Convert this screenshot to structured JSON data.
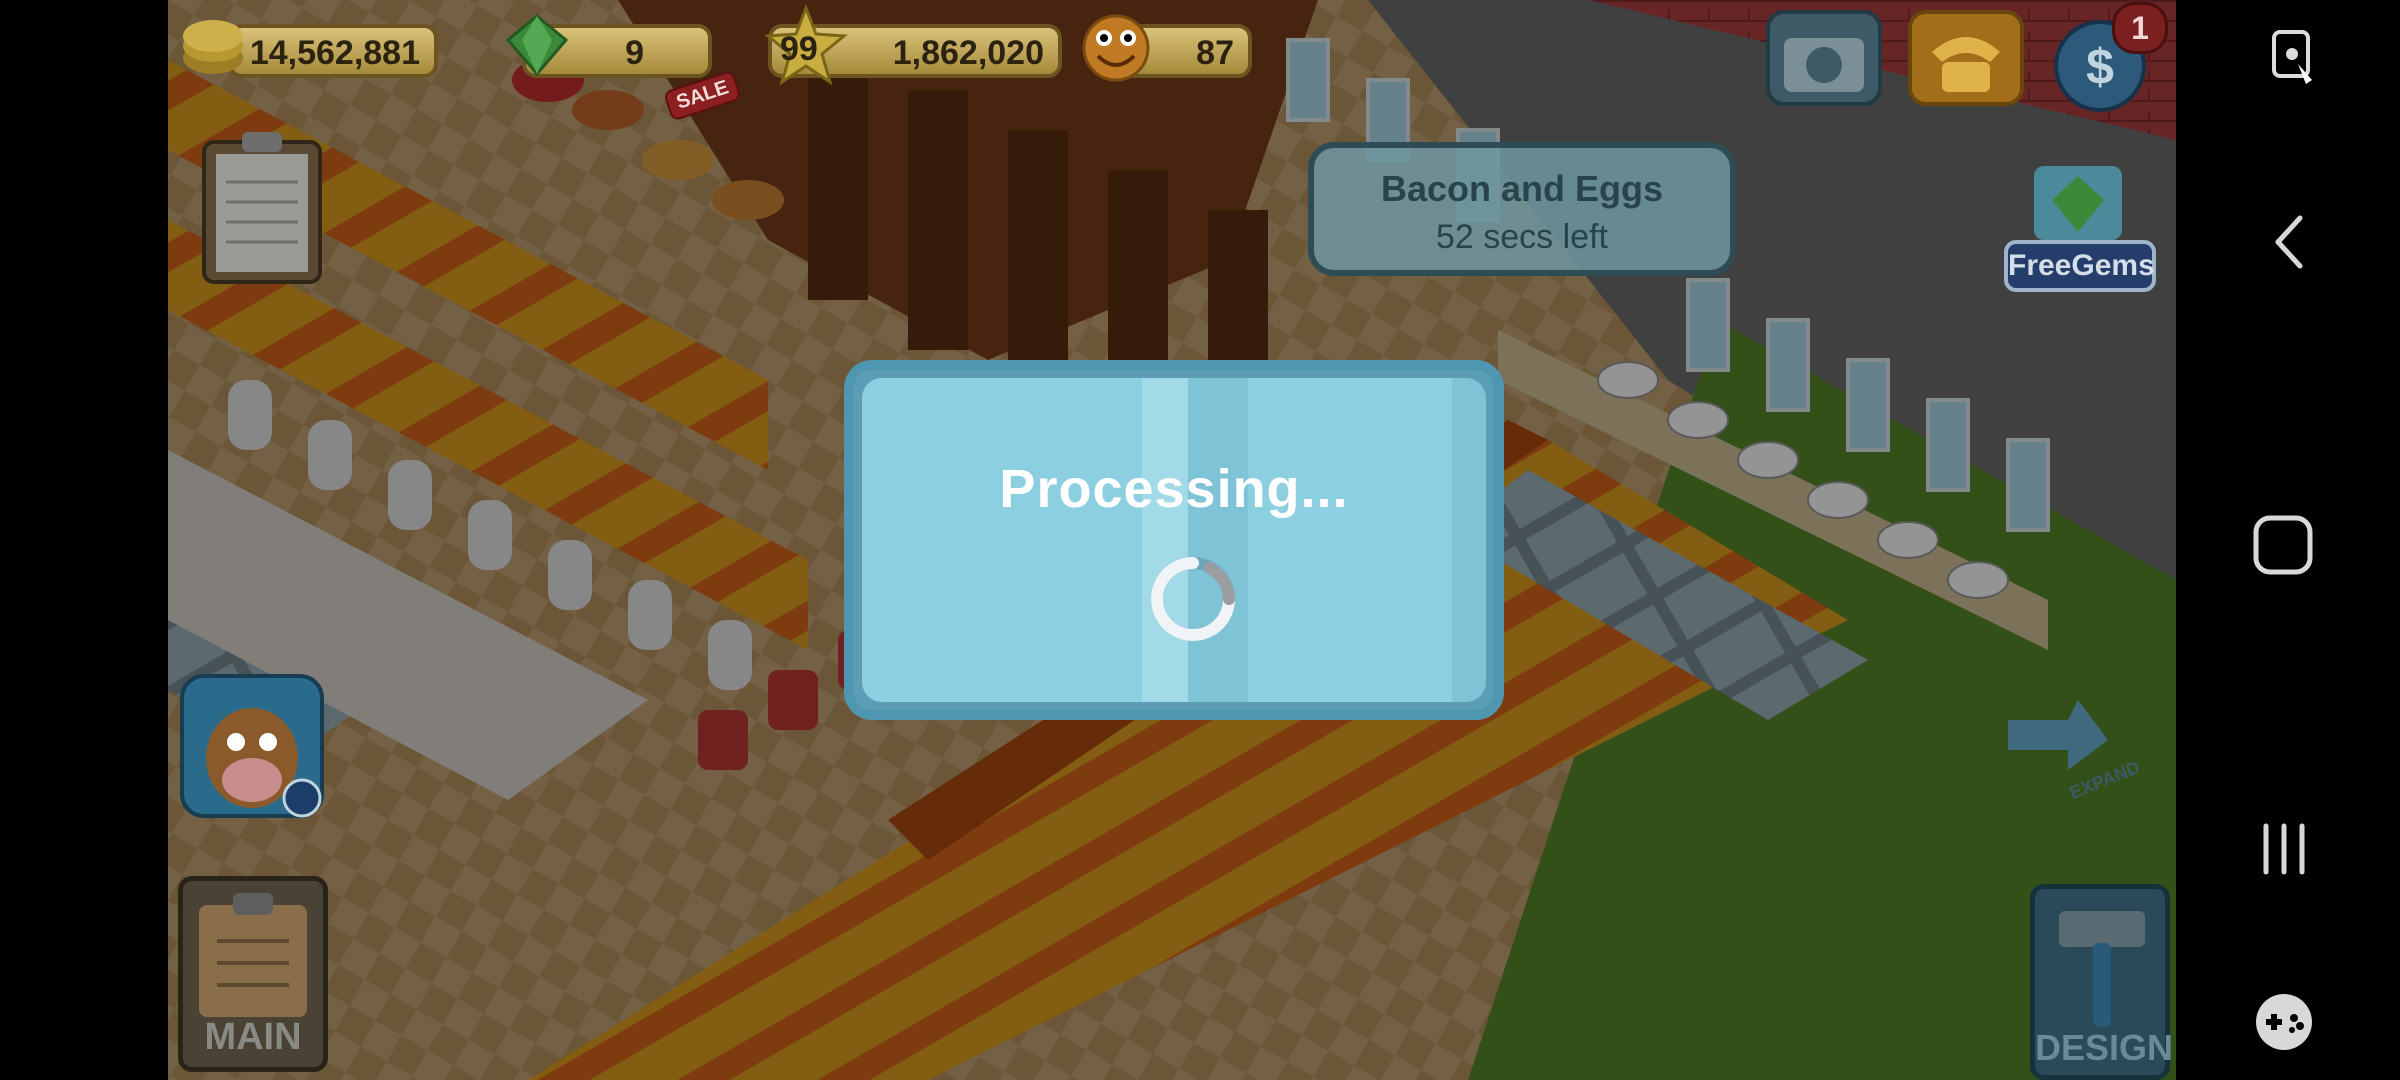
{
  "hud": {
    "coins": "14,562,881",
    "gems": "9",
    "gems_badge": "SALE",
    "level": "99",
    "xp": "1,862,020",
    "happiness": "87",
    "notifications_count": "1",
    "free_gems_label": "FreeGems",
    "main_label": "MAIN",
    "design_label": "DESIGN",
    "expand_label": "EXPAND"
  },
  "order_toast": {
    "dish": "Bacon and Eggs",
    "time_left": "52 secs left"
  },
  "dialog": {
    "title": "Processing..."
  },
  "colors": {
    "dialog_bg": "#8ccfe0",
    "dialog_border": "#4f97b0",
    "coin_pill": "#d9c27a",
    "dim_overlay": "rgba(0,0,0,0.42)"
  },
  "icons": {
    "coins": "coin-stack-icon",
    "gems": "gem-icon",
    "level": "star-icon",
    "happiness": "smiley-icon",
    "camera": "camera-icon",
    "phone": "phone-icon",
    "currency": "currency-icon",
    "clipboard": "clipboard-icon",
    "farm_app": "cow-app-icon",
    "back": "back-arrow-icon",
    "home": "home-square-icon",
    "recents": "recents-icon",
    "game_tools": "gamepad-icon",
    "screen_lock": "screen-touch-lock-icon"
  }
}
